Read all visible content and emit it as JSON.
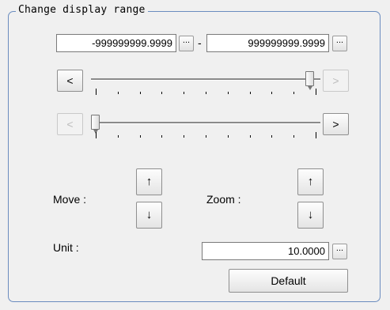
{
  "group": {
    "title": "Change display range"
  },
  "range": {
    "min_value": "-999999999.9999",
    "max_value": "999999999.9999",
    "separator": "-",
    "ellipsis": "..."
  },
  "slider_max": {
    "left_button": "<",
    "right_button": ">",
    "right_disabled": true,
    "position": 1.0
  },
  "slider_min": {
    "left_button": "<",
    "right_button": ">",
    "left_disabled": true,
    "position": 0.0
  },
  "move": {
    "label": "Move :",
    "up_icon": "↑",
    "down_icon": "↓"
  },
  "zoom": {
    "label": "Zoom :",
    "up_icon": "↑",
    "down_icon": "↓"
  },
  "unit": {
    "label": "Unit :",
    "value": "10.0000",
    "ellipsis": "..."
  },
  "default_button": {
    "label": "Default"
  }
}
